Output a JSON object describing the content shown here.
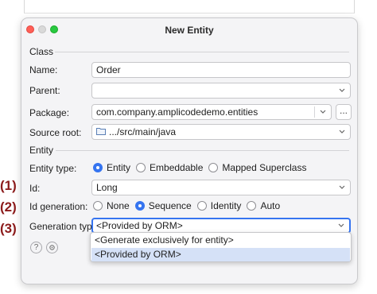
{
  "window": {
    "title": "New Entity"
  },
  "class_section": {
    "header": "Class",
    "name": {
      "label": "Name:",
      "value": "Order"
    },
    "parent": {
      "label": "Parent:",
      "value": ""
    },
    "package": {
      "label": "Package:",
      "value": "com.company.amplicodedemo.entities",
      "browse_label": "..."
    },
    "source_root": {
      "label": "Source root:",
      "value": ".../src/main/java"
    }
  },
  "entity_section": {
    "header": "Entity",
    "entity_type": {
      "label": "Entity type:",
      "options": [
        "Entity",
        "Embeddable",
        "Mapped Superclass"
      ],
      "selected": "Entity"
    },
    "id": {
      "label": "Id:",
      "value": "Long"
    },
    "id_generation": {
      "label": "Id generation:",
      "options": [
        "None",
        "Sequence",
        "Identity",
        "Auto"
      ],
      "selected": "Sequence"
    },
    "generation_type": {
      "label": "Generation type:",
      "value": "<Provided by ORM>",
      "dropdown_options": [
        "<Generate exclusively for entity>",
        "<Provided by ORM>"
      ],
      "highlighted": "<Provided by ORM>"
    }
  },
  "annotations": [
    "(1)",
    "(2)",
    "(3)"
  ],
  "footer": {
    "help_icon": "?",
    "settings_icon": "gear-icon"
  },
  "colors": {
    "accent": "#3574f0",
    "annotation": "#8b1a1a",
    "highlight": "#d5e1f7"
  }
}
